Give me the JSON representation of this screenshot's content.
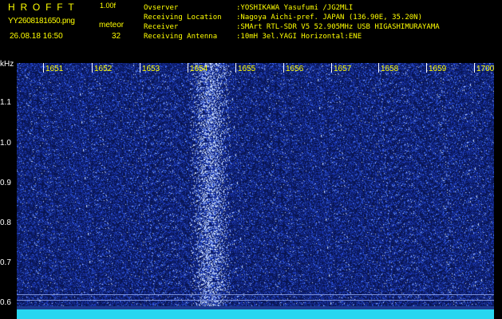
{
  "header": {
    "logo": "HROFFT",
    "version": "1.00f",
    "filename": "YY2608181650.png",
    "datetime": "26.08.18 16:50",
    "meteor_label": "meteor",
    "meteor_count": "32",
    "info": [
      {
        "label": "Ovserver",
        "value": ":YOSHIKAWA Yasufumi /JG2MLI"
      },
      {
        "label": "Receiving Location",
        "value": ":Nagoya Aichi-pref. JAPAN (136.90E, 35.20N)"
      },
      {
        "label": "Receiver",
        "value": ":SMArt RTL-SDR V5 52.905MHz USB HIGASHIMURAYAMA"
      },
      {
        "label": "Receiving Antenna",
        "value": ":10mH 3el.YAGI Horizontal:ENE"
      }
    ]
  },
  "axes": {
    "y_unit": "kHz",
    "y_ticks": [
      "1.1",
      "1.0",
      "0.9",
      "0.8",
      "0.7",
      "0.6"
    ],
    "x_ticks": [
      "1651",
      "1652",
      "1653",
      "1654",
      "1655",
      "1656",
      "1657",
      "1658",
      "1659",
      "1700"
    ]
  },
  "colors": {
    "background": "#000000",
    "header_text": "#ffff00",
    "plot_base": "#0e1d5e",
    "echo_column": "#5a88ff",
    "bottom_band": "#28d6f0"
  }
}
